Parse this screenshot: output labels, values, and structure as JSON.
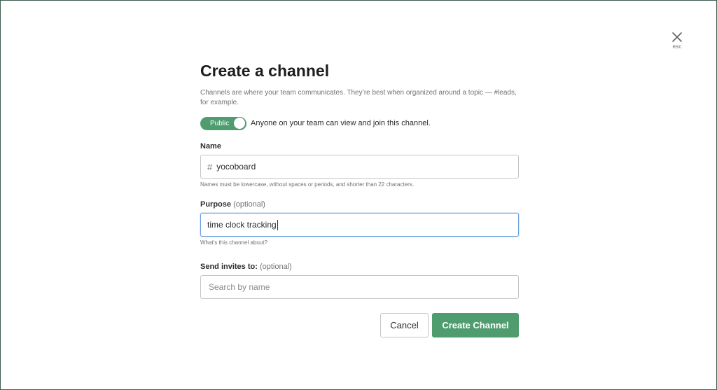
{
  "close": {
    "icon": "close-icon",
    "hint": "esc"
  },
  "dialog": {
    "title": "Create a channel",
    "description": "Channels are where your team communicates. They’re best when organized around a topic — #leads, for example."
  },
  "privacy": {
    "toggle_label": "Public",
    "toggle_on": true,
    "description": "Anyone on your team can view and join this channel.",
    "accent_color": "#4f9c6f"
  },
  "name_field": {
    "label": "Name",
    "prefix_icon": "hash-icon",
    "prefix": "#",
    "value": "yocoboard",
    "hint": "Names must be lowercase, without spaces or periods, and shorter than 22 characters."
  },
  "purpose_field": {
    "label": "Purpose",
    "optional": "(optional)",
    "value": "time clock tracking",
    "hint": "What’s this channel about?"
  },
  "invites_field": {
    "label": "Send invites to:",
    "optional": "(optional)",
    "placeholder": "Search by name"
  },
  "actions": {
    "cancel_label": "Cancel",
    "create_label": "Create Channel",
    "create_color": "#4f9c6f"
  }
}
